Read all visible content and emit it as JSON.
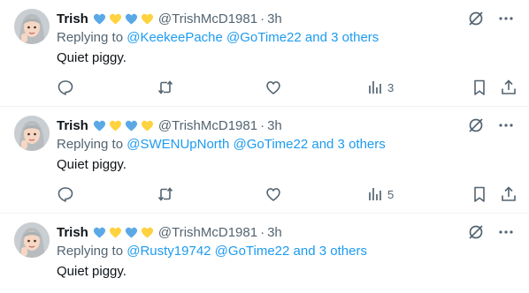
{
  "tweets": [
    {
      "name": "Trish",
      "hearts": [
        "blue",
        "yellow",
        "blue",
        "yellow"
      ],
      "handle": "@TrishMcD1981",
      "separator": "·",
      "time": "3h",
      "reply_prefix": "Replying to",
      "reply_links": [
        "@KeekeePache",
        "@GoTime22",
        "and 3 others"
      ],
      "text": "Quiet piggy.",
      "views": "3"
    },
    {
      "name": "Trish",
      "hearts": [
        "blue",
        "yellow",
        "blue",
        "yellow"
      ],
      "handle": "@TrishMcD1981",
      "separator": "·",
      "time": "3h",
      "reply_prefix": "Replying to",
      "reply_links": [
        "@SWENUpNorth",
        "@GoTime22",
        "and 3 others"
      ],
      "text": "Quiet piggy.",
      "views": "5"
    },
    {
      "name": "Trish",
      "hearts": [
        "blue",
        "yellow",
        "blue",
        "yellow"
      ],
      "handle": "@TrishMcD1981",
      "separator": "·",
      "time": "3h",
      "reply_prefix": "Replying to",
      "reply_links": [
        "@Rusty19742",
        "@GoTime22",
        "and 3 others"
      ],
      "text": "Quiet piggy."
    }
  ],
  "colors": {
    "link": "#1d9bf0",
    "secondary": "#536471",
    "heart_blue": "#5aa9e6",
    "heart_yellow": "#ffd23f"
  }
}
